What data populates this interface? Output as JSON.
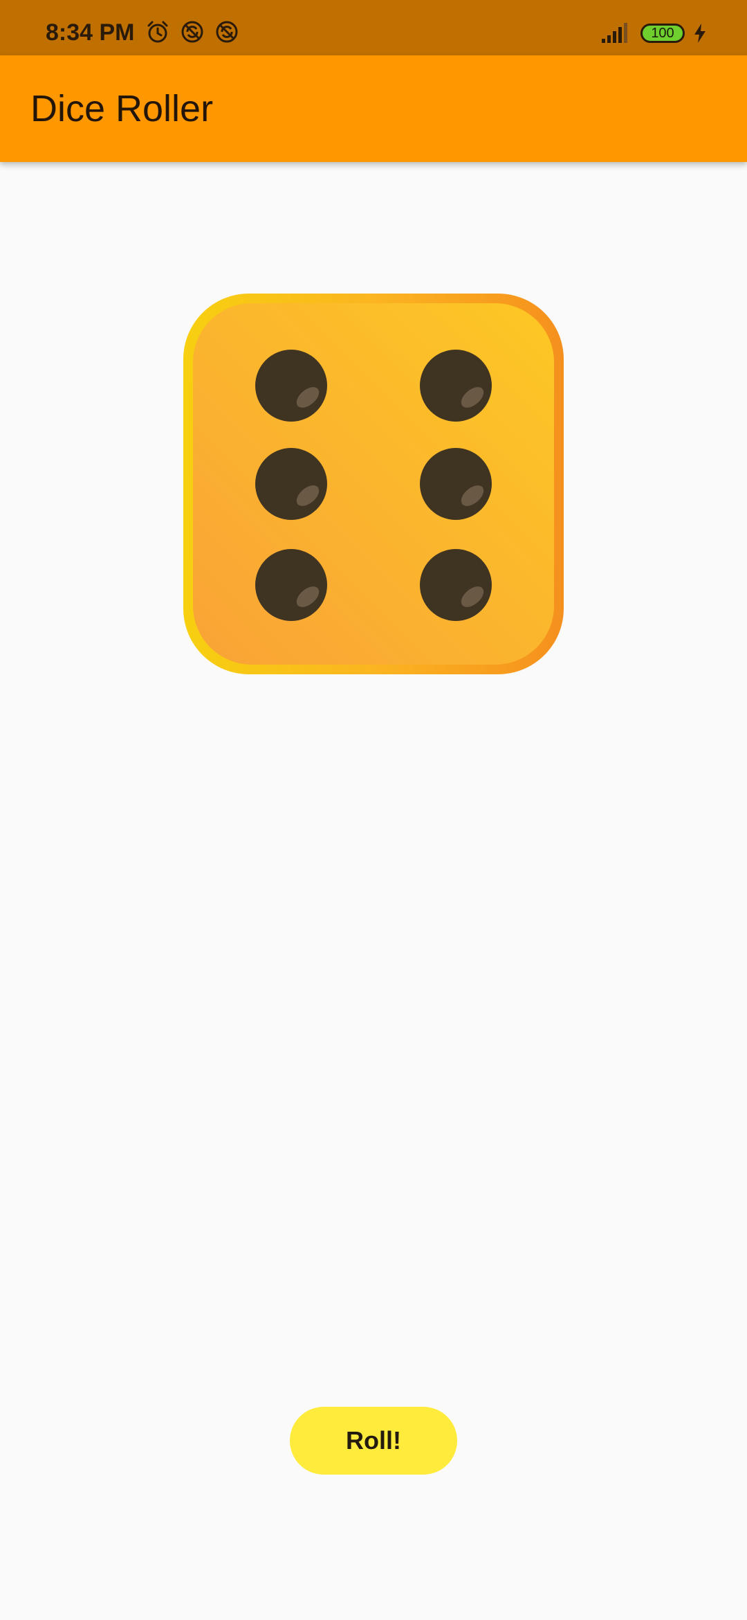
{
  "status_bar": {
    "time": "8:34 PM",
    "battery_level": "100",
    "icons": [
      "alarm-icon",
      "sync-off-icon",
      "sync-off-icon",
      "signal-icon",
      "battery-icon",
      "charging-icon"
    ]
  },
  "app_bar": {
    "title": "Dice Roller",
    "color": "#ff9800"
  },
  "dice": {
    "face_value": 6,
    "pip_count_label": "six"
  },
  "roll_button": {
    "label": "Roll!",
    "color": "#ffeb3b"
  }
}
